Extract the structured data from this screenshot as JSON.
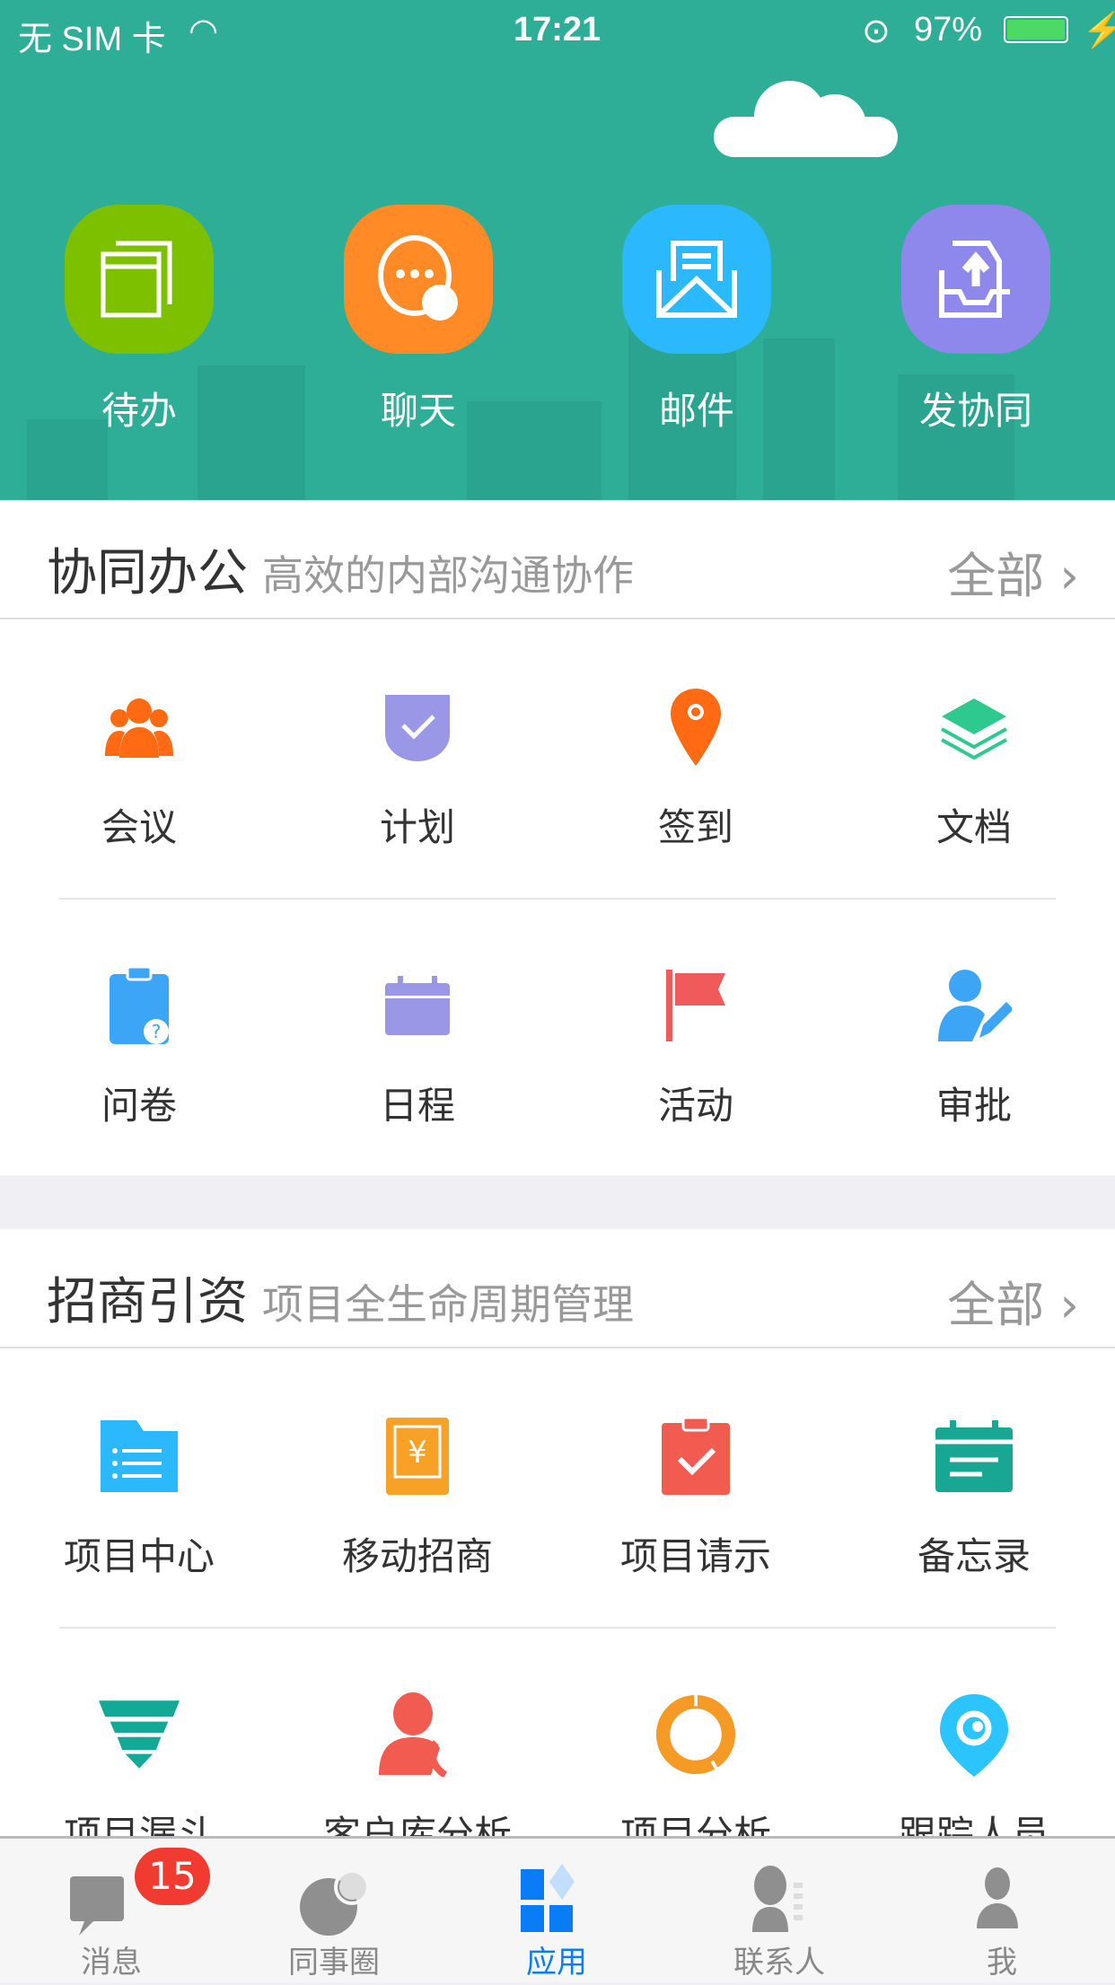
{
  "status_bar": {
    "carrier": "无 SIM 卡",
    "time": "17:21",
    "battery": "97%"
  },
  "quick_actions": [
    {
      "label": "待办",
      "icon": "windows-icon",
      "color": "#7dc000"
    },
    {
      "label": "聊天",
      "icon": "chat-icon",
      "color": "#ff8a26"
    },
    {
      "label": "邮件",
      "icon": "mail-icon",
      "color": "#2bb8fc"
    },
    {
      "label": "发协同",
      "icon": "send-inbox-icon",
      "color": "#8e87ec"
    }
  ],
  "sections": [
    {
      "title": "协同办公",
      "subtitle": "高效的内部沟通协作",
      "all": "全部",
      "items": [
        {
          "label": "会议",
          "icon": "meeting-icon"
        },
        {
          "label": "计划",
          "icon": "plan-shield-icon"
        },
        {
          "label": "签到",
          "icon": "location-pin-icon"
        },
        {
          "label": "文档",
          "icon": "layers-icon"
        },
        {
          "label": "问卷",
          "icon": "survey-clipboard-icon"
        },
        {
          "label": "日程",
          "icon": "calendar-icon"
        },
        {
          "label": "活动",
          "icon": "flag-icon"
        },
        {
          "label": "审批",
          "icon": "approve-user-icon"
        }
      ]
    },
    {
      "title": "招商引资",
      "subtitle": "项目全生命周期管理",
      "all": "全部",
      "items": [
        {
          "label": "项目中心",
          "icon": "folder-list-icon"
        },
        {
          "label": "移动招商",
          "icon": "yen-phone-icon"
        },
        {
          "label": "项目请示",
          "icon": "check-clipboard-icon"
        },
        {
          "label": "备忘录",
          "icon": "memo-calendar-icon"
        },
        {
          "label": "项目漏斗",
          "icon": "funnel-icon"
        },
        {
          "label": "客户库分析",
          "icon": "contact-phone-icon"
        },
        {
          "label": "项目分析",
          "icon": "donut-icon"
        },
        {
          "label": "跟踪人员",
          "icon": "eye-pin-icon"
        }
      ]
    }
  ],
  "tabbar": {
    "active": "应用",
    "accent": "#0a7cf5",
    "items": [
      {
        "label": "消息",
        "badge": "15"
      },
      {
        "label": "同事圈"
      },
      {
        "label": "应用"
      },
      {
        "label": "联系人"
      },
      {
        "label": "我"
      }
    ]
  }
}
